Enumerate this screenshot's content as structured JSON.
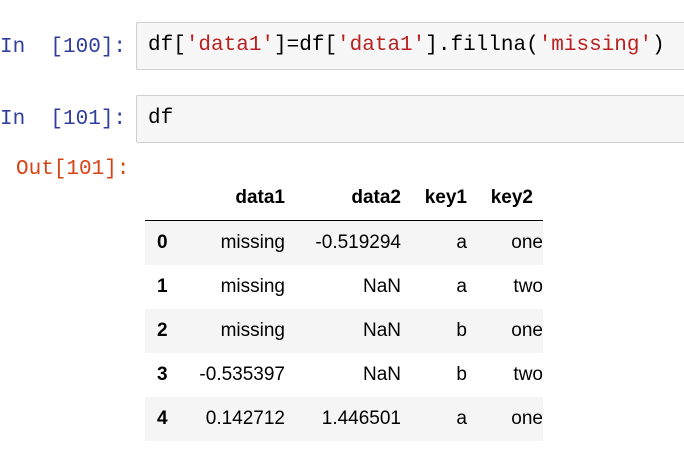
{
  "cells": [
    {
      "prompt": "In  [100]:",
      "code": {
        "p1": "df[",
        "s1": "'data1'",
        "p2": "]=df[",
        "s2": "'data1'",
        "p3": "].fillna(",
        "s3": "'missing'",
        "p4": ")"
      }
    },
    {
      "prompt": "In  [101]:",
      "code": {
        "p1": "df"
      }
    }
  ],
  "output": {
    "prompt": "Out[101]:",
    "columns": [
      "",
      "data1",
      "data2",
      "key1",
      "key2"
    ],
    "rows": [
      {
        "index": "0",
        "data1": "missing",
        "data2": "-0.519294",
        "key1": "a",
        "key2": "one"
      },
      {
        "index": "1",
        "data1": "missing",
        "data2": "NaN",
        "key1": "a",
        "key2": "two"
      },
      {
        "index": "2",
        "data1": "missing",
        "data2": "NaN",
        "key1": "b",
        "key2": "one"
      },
      {
        "index": "3",
        "data1": "-0.535397",
        "data2": "NaN",
        "key1": "b",
        "key2": "two"
      },
      {
        "index": "4",
        "data1": "0.142712",
        "data2": "1.446501",
        "key1": "a",
        "key2": "one"
      }
    ]
  }
}
